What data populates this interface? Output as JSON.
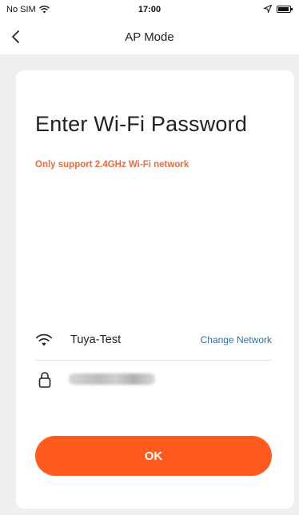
{
  "status_bar": {
    "carrier": "No SIM",
    "time": "17:00"
  },
  "nav": {
    "back_icon": "chevron-left-icon",
    "title": "AP Mode"
  },
  "card": {
    "title": "Enter Wi-Fi Password",
    "subtitle": "Only support 2.4GHz Wi-Fi network",
    "network": {
      "icon": "wifi-icon",
      "name": "Tuya-Test",
      "change_label": "Change Network"
    },
    "password": {
      "icon": "lock-icon",
      "value": ""
    },
    "ok_label": "OK"
  },
  "colors": {
    "accent": "#ff5b1f",
    "subtitle": "#ec6a3c",
    "link": "#2f6fb4",
    "background_gray": "#efefef"
  }
}
